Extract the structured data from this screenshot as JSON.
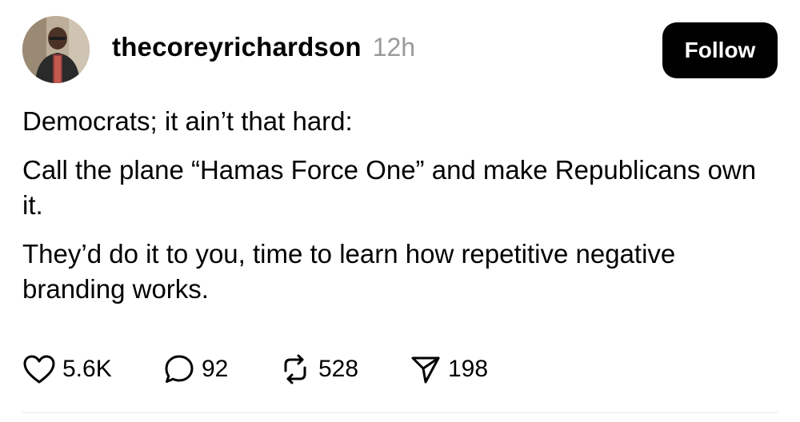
{
  "post": {
    "username": "thecoreyrichardson",
    "timestamp": "12h",
    "follow_label": "Follow",
    "paragraphs": [
      "Democrats; it ain’t that hard:",
      "Call the plane “Hamas Force One” and make Republicans own it.",
      "They’d do it to you, time to learn how repetitive negative branding works."
    ],
    "actions": {
      "likes": "5.6K",
      "replies": "92",
      "reposts": "528",
      "shares": "198"
    },
    "icons": {
      "like": "heart-icon",
      "reply": "speech-bubble-icon",
      "repost": "repost-arrows-icon",
      "share": "paper-plane-icon"
    }
  }
}
